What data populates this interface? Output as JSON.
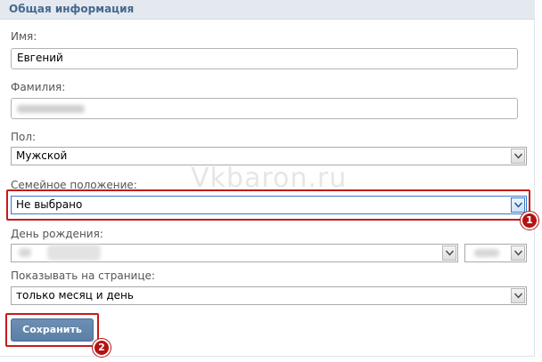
{
  "header": {
    "title": "Общая информация"
  },
  "form": {
    "first_name": {
      "label": "Имя:",
      "value": "Евгений"
    },
    "last_name": {
      "label": "Фамилия:",
      "value": ""
    },
    "gender": {
      "label": "Пол:",
      "value": "Мужской"
    },
    "relationship": {
      "label": "Семейное положение:",
      "value": "Не выбрано"
    },
    "birthday": {
      "label": "День рождения:"
    },
    "show_on_page": {
      "label": "Показывать на странице:",
      "value": "только месяц и день"
    }
  },
  "save_button": {
    "label": "Сохранить"
  },
  "annotations": {
    "badge_1": "1",
    "badge_2": "2"
  },
  "watermark": {
    "text": "Vkbaron.ru"
  },
  "colors": {
    "accent": "#45688e",
    "highlight": "#c41b1b",
    "button": "#5b7fa6"
  }
}
